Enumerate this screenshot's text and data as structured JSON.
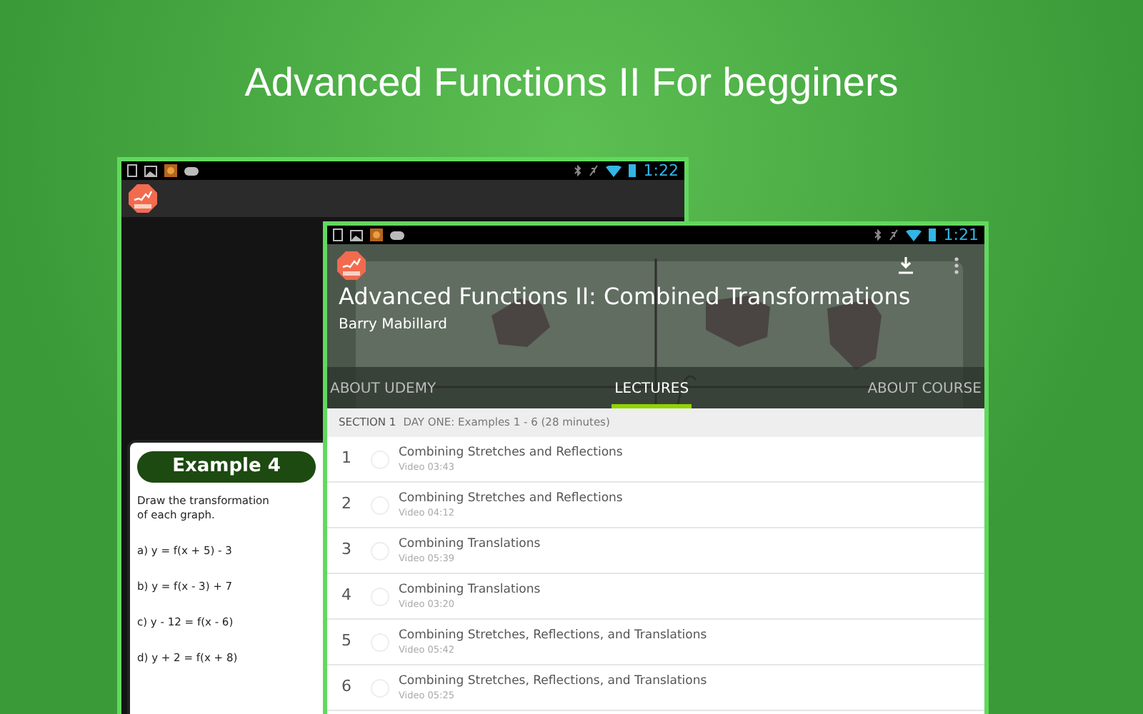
{
  "headline": "Advanced Functions II For begginers",
  "back_screen": {
    "status_bar": {
      "time": "1:22"
    },
    "slide": {
      "title": "Example 4",
      "instruction": "Draw the transformation of each graph.",
      "problems": [
        "a) y = f(x + 5) - 3",
        "b) y = f(x - 3) + 7",
        "c) y - 12 = f(x - 6)",
        "d) y + 2 = f(x + 8)"
      ]
    }
  },
  "front_screen": {
    "status_bar": {
      "time": "1:21"
    },
    "course": {
      "title": "Advanced Functions II: Combined Transformations",
      "author": "Barry Mabillard"
    },
    "tabs": [
      {
        "label": "ABOUT UDEMY",
        "selected": false
      },
      {
        "label": "LECTURES",
        "selected": true
      },
      {
        "label": "ABOUT COURSE",
        "selected": false
      }
    ],
    "section": {
      "label": "SECTION 1",
      "title": "DAY ONE: Examples 1 - 6 (28 minutes)"
    },
    "lectures": [
      {
        "number": "1",
        "title": "Combining Stretches and Reflections",
        "meta": "Video 03:43"
      },
      {
        "number": "2",
        "title": "Combining Stretches and Reflections",
        "meta": "Video 04:12"
      },
      {
        "number": "3",
        "title": "Combining Translations",
        "meta": "Video 05:39"
      },
      {
        "number": "4",
        "title": "Combining Translations",
        "meta": "Video 03:20"
      },
      {
        "number": "5",
        "title": "Combining Stretches, Reflections, and Translations",
        "meta": "Video 05:42"
      },
      {
        "number": "6",
        "title": "Combining Stretches, Reflections, and Translations",
        "meta": "Video 05:25"
      }
    ]
  }
}
